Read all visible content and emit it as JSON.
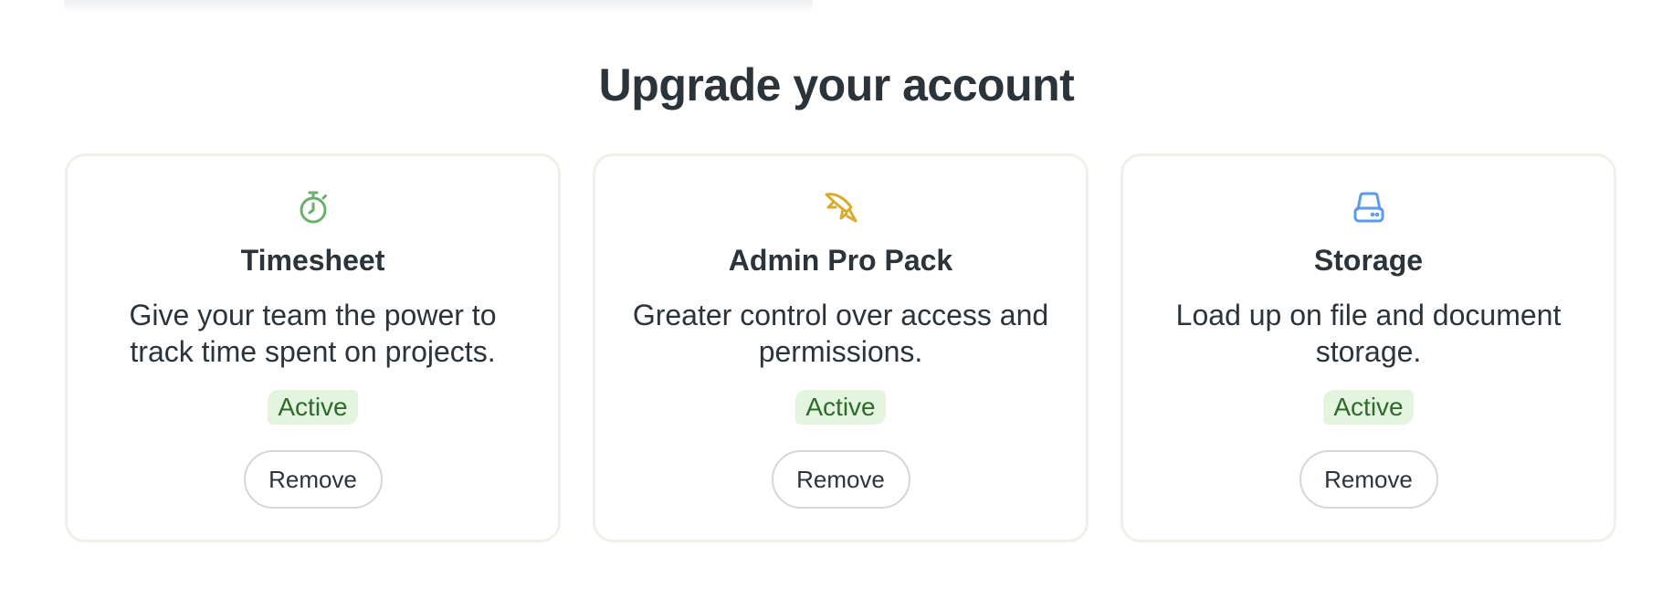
{
  "page": {
    "title": "Upgrade your account"
  },
  "cards": [
    {
      "icon": "stopwatch-icon",
      "icon_color": "#6ab06a",
      "title": "Timesheet",
      "description": "Give your team the power to track time spent on projects.",
      "status": "Active",
      "button_label": "Remove"
    },
    {
      "icon": "rocket-icon",
      "icon_color": "#d9aa2c",
      "title": "Admin Pro Pack",
      "description": "Greater control over access and permissions.",
      "status": "Active",
      "button_label": "Remove"
    },
    {
      "icon": "hard-drive-icon",
      "icon_color": "#5b9bea",
      "title": "Storage",
      "description": "Load up on file and document storage.",
      "status": "Active",
      "button_label": "Remove"
    }
  ],
  "colors": {
    "status_badge_bg": "#e3f4df",
    "status_badge_text": "#2e6b2b",
    "card_border": "#f1f0e8",
    "text": "#2b333b"
  }
}
